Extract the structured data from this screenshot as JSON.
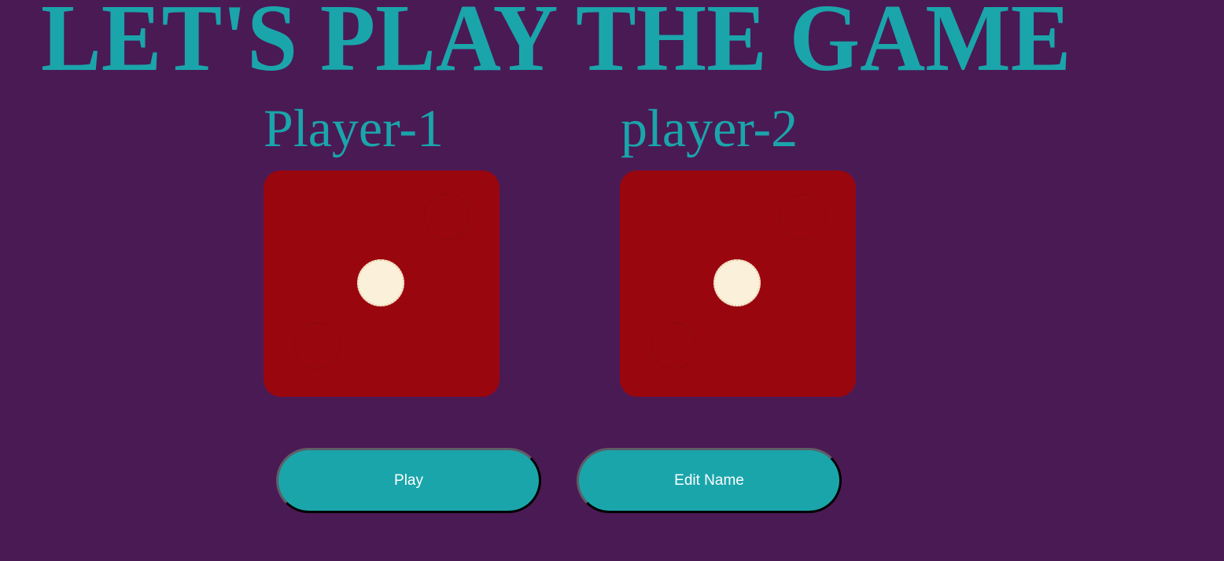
{
  "title": "LET'S PLAY THE GAME",
  "players": [
    {
      "label": "Player-1",
      "die_value": 1
    },
    {
      "label": "player-2",
      "die_value": 1
    }
  ],
  "buttons": {
    "play_label": "Play",
    "edit_name_label": "Edit Name"
  },
  "colors": {
    "background": "#4a1a55",
    "accent": "#1aa5ab",
    "die": "#9a060e",
    "pip": "#fbf0da",
    "button_text": "#ffffff"
  }
}
